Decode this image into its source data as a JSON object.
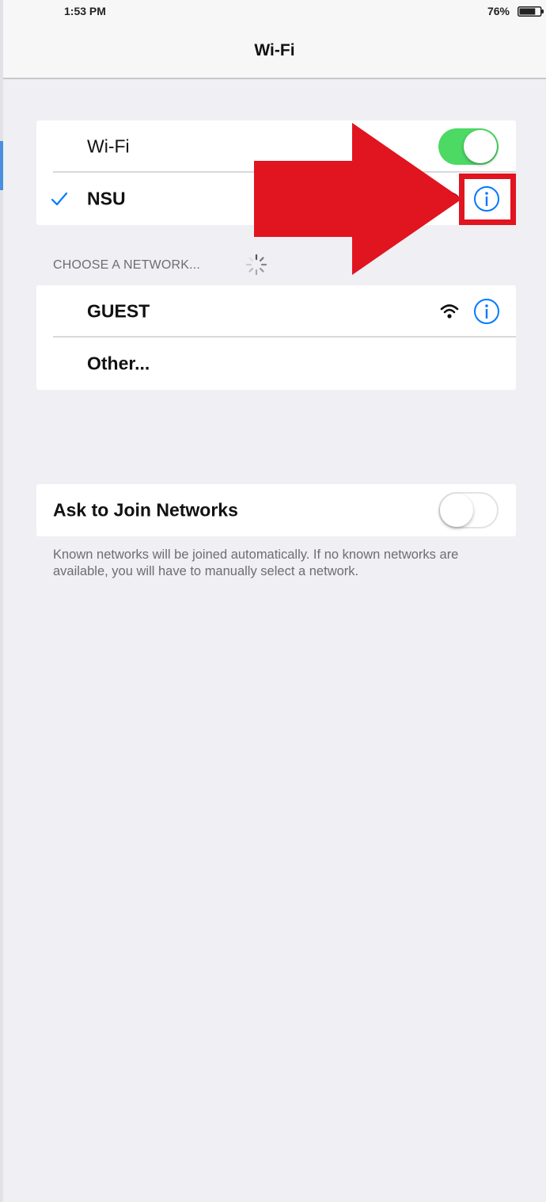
{
  "status_bar": {
    "time": "1:53 PM",
    "battery_percent": "76%",
    "battery_level": 0.76
  },
  "nav": {
    "title": "Wi-Fi"
  },
  "wifi_section": {
    "toggle_label": "Wi-Fi",
    "toggle_state": "on",
    "connected_network": "NSU"
  },
  "choose_section": {
    "header": "CHOOSE A NETWORK...",
    "networks": [
      {
        "name": "GUEST"
      }
    ],
    "other_label": "Other..."
  },
  "ask_section": {
    "label": "Ask to Join Networks",
    "toggle_state": "off",
    "footer": "Known networks will be joined automatically. If no known networks are available, you will have to manually select a network."
  },
  "colors": {
    "toggle_on": "#4cd964",
    "ios_blue": "#007aff",
    "annotation_red": "#e0151f",
    "background": "#efeff4"
  }
}
